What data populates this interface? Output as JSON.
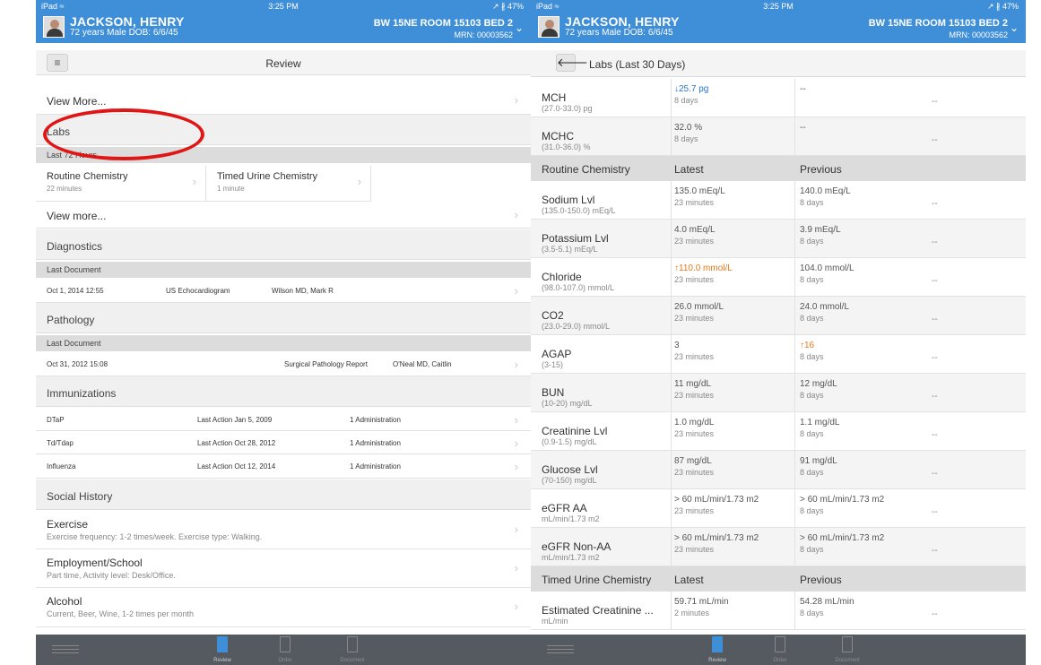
{
  "status": {
    "carrier": "iPad ≈",
    "time": "3:25 PM",
    "battery": "↗ ∦ 47%"
  },
  "patient": {
    "name": "JACKSON, HENRY",
    "info": "72 years  Male  DOB: 6/6/45",
    "location": "BW 15NE ROOM 15103 BED 2",
    "mrn": "MRN: 00003562"
  },
  "left": {
    "nav_title": "Review",
    "view_more_top": "View More...",
    "labs": {
      "title": "Labs",
      "sub": "Last 72 Hours",
      "cards": [
        {
          "title": "Routine Chemistry",
          "time": "22 minutes"
        },
        {
          "title": "Timed Urine Chemistry",
          "time": "1 minute"
        }
      ],
      "view_more": "View more..."
    },
    "diagnostics": {
      "title": "Diagnostics",
      "sub": "Last Document",
      "date": "Oct 1, 2014 12:55",
      "doc": "US Echocardiogram",
      "author": "Wilson MD, Mark R"
    },
    "pathology": {
      "title": "Pathology",
      "sub": "Last Document",
      "date": "Oct 31, 2012 15:08",
      "doc": "Surgical Pathology Report",
      "author": "O'Neal MD, Caitlin"
    },
    "immunizations": {
      "title": "Immunizations",
      "items": [
        {
          "name": "DTaP",
          "action": "Last Action Jan 5, 2009",
          "count": "1 Administration"
        },
        {
          "name": "Td/Tdap",
          "action": "Last Action Oct 28, 2012",
          "count": "1 Administration"
        },
        {
          "name": "Influenza",
          "action": "Last Action Oct 12, 2014",
          "count": "1 Administration"
        }
      ]
    },
    "social": {
      "title": "Social History",
      "items": [
        {
          "title": "Exercise",
          "detail": "Exercise frequency: 1-2 times/week. Exercise type: Walking."
        },
        {
          "title": "Employment/School",
          "detail": "Part time, Activity level: Desk/Office."
        },
        {
          "title": "Alcohol",
          "detail": "Current, Beer, Wine, 1-2 times per month"
        }
      ]
    }
  },
  "right": {
    "nav_title": "Labs (Last 30 Days)",
    "rows_top": [
      {
        "name": "MCH",
        "range": "(27.0-33.0) pg",
        "latest": "↓25.7 pg",
        "latest_age": "8 days",
        "prev": "--",
        "prev_age": "",
        "third": "--",
        "flag": "low"
      },
      {
        "name": "MCHC",
        "range": "(31.0-36.0) %",
        "latest": "32.0 %",
        "latest_age": "8 days",
        "prev": "--",
        "prev_age": "",
        "third": "--",
        "flag": ""
      }
    ],
    "routine": {
      "title": "Routine Chemistry",
      "latest_col": "Latest",
      "prev_col": "Previous",
      "rows": [
        {
          "name": "Sodium Lvl",
          "range": "(135.0-150.0) mEq/L",
          "latest": "135.0 mEq/L",
          "latest_age": "23 minutes",
          "prev": "140.0 mEq/L",
          "prev_age": "8 days",
          "third": "--",
          "flag": ""
        },
        {
          "name": "Potassium Lvl",
          "range": "(3.5-5.1) mEq/L",
          "latest": "4.0 mEq/L",
          "latest_age": "23 minutes",
          "prev": "3.9 mEq/L",
          "prev_age": "8 days",
          "third": "--",
          "flag": ""
        },
        {
          "name": "Chloride",
          "range": "(98.0-107.0) mmol/L",
          "latest": "↑110.0 mmol/L",
          "latest_age": "23 minutes",
          "prev": "104.0 mmol/L",
          "prev_age": "8 days",
          "third": "--",
          "flag": "high"
        },
        {
          "name": "CO2",
          "range": "(23.0-29.0) mmol/L",
          "latest": "26.0 mmol/L",
          "latest_age": "23 minutes",
          "prev": "24.0 mmol/L",
          "prev_age": "8 days",
          "third": "--",
          "flag": ""
        },
        {
          "name": "AGAP",
          "range": "(3-15)",
          "latest": "3",
          "latest_age": "23 minutes",
          "prev": "↑16",
          "prev_age": "8 days",
          "third": "--",
          "flag": "prevhigh"
        },
        {
          "name": "BUN",
          "range": "(10-20) mg/dL",
          "latest": "11 mg/dL",
          "latest_age": "23 minutes",
          "prev": "12 mg/dL",
          "prev_age": "8 days",
          "third": "--",
          "flag": ""
        },
        {
          "name": "Creatinine Lvl",
          "range": "(0.9-1.5) mg/dL",
          "latest": "1.0 mg/dL",
          "latest_age": "23 minutes",
          "prev": "1.1 mg/dL",
          "prev_age": "8 days",
          "third": "--",
          "flag": ""
        },
        {
          "name": "Glucose Lvl",
          "range": "(70-150) mg/dL",
          "latest": "87 mg/dL",
          "latest_age": "23 minutes",
          "prev": "91 mg/dL",
          "prev_age": "8 days",
          "third": "--",
          "flag": ""
        },
        {
          "name": "eGFR AA",
          "range": "mL/min/1.73 m2",
          "latest": "> 60 mL/min/1.73 m2",
          "latest_age": "23 minutes",
          "prev": "> 60 mL/min/1.73 m2",
          "prev_age": "8 days",
          "third": "--",
          "flag": ""
        },
        {
          "name": "eGFR Non-AA",
          "range": "mL/min/1.73 m2",
          "latest": "> 60 mL/min/1.73 m2",
          "latest_age": "23 minutes",
          "prev": "> 60 mL/min/1.73 m2",
          "prev_age": "8 days",
          "third": "--",
          "flag": ""
        }
      ]
    },
    "urine": {
      "title": "Timed Urine Chemistry",
      "latest_col": "Latest",
      "prev_col": "Previous",
      "rows": [
        {
          "name": "Estimated Creatinine ...",
          "range": "mL/min",
          "latest": "59.71 mL/min",
          "latest_age": "2 minutes",
          "prev": "54.28 mL/min",
          "prev_age": "8 days",
          "third": "--",
          "flag": ""
        }
      ]
    }
  },
  "tabs": [
    {
      "label": "Review",
      "icon": "clipboard-icon",
      "active": true
    },
    {
      "label": "Order",
      "icon": "order-icon",
      "active": false
    },
    {
      "label": "Document",
      "icon": "document-icon",
      "active": false
    }
  ],
  "colors": {
    "header": "#3e8ed8",
    "tabbar": "#555a60",
    "highlight_circle": "#e01616",
    "low_flag": "#2a75c9",
    "high_flag": "#e8781b"
  }
}
